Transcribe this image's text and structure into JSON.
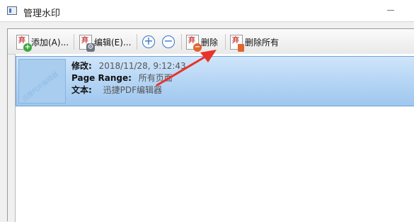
{
  "window": {
    "title": "管理水印"
  },
  "toolbar": {
    "add_label": "添加(A)...",
    "edit_label": "编辑(E)...",
    "zoom_in_symbol": "+",
    "zoom_out_symbol": "−",
    "delete_label": "删除",
    "delete_all_label": "删除所有"
  },
  "watermark": {
    "modified_label": "修改:",
    "modified_value": "2018/11/28, 9:12:43",
    "page_range_label": "Page Range:",
    "page_range_value": "所有页面",
    "text_label": "文本:",
    "text_value": "迅捷PDF编辑器"
  },
  "annotation": {
    "arrow_color": "#e8332a"
  }
}
